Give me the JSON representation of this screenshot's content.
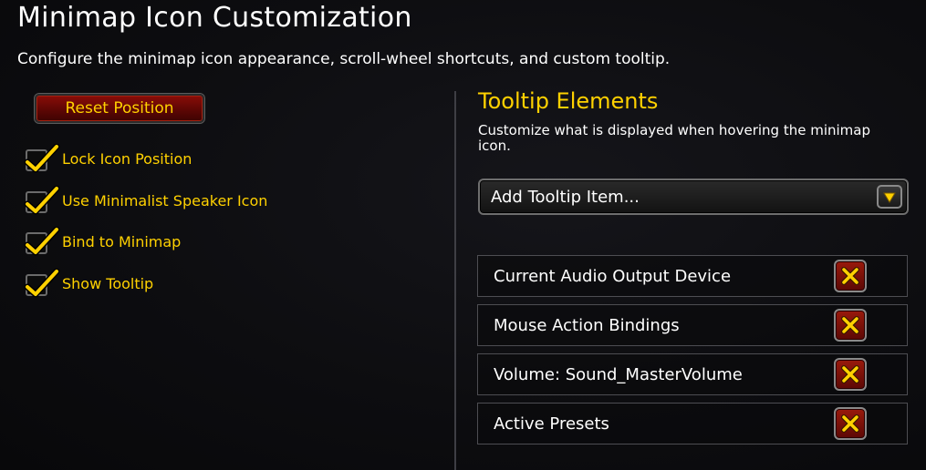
{
  "header": {
    "title": "Minimap Icon Customization",
    "subtitle": "Configure the minimap icon appearance, scroll-wheel shortcuts, and custom tooltip."
  },
  "left_panel": {
    "reset_button_label": "Reset Position",
    "checkboxes": [
      {
        "label": "Lock Icon Position",
        "checked": true
      },
      {
        "label": "Use Minimalist Speaker Icon",
        "checked": true
      },
      {
        "label": "Bind to Minimap",
        "checked": true
      },
      {
        "label": "Show Tooltip",
        "checked": true
      }
    ]
  },
  "right_panel": {
    "section_title": "Tooltip Elements",
    "section_description": "Customize what is displayed when hovering the minimap icon.",
    "dropdown": {
      "selected": "Add Tooltip Item...",
      "arrow_icon": "chevron-down-icon"
    },
    "tooltip_items": [
      {
        "label": "Current Audio Output Device",
        "remove_icon": "close-icon"
      },
      {
        "label": "Mouse Action Bindings",
        "remove_icon": "close-icon"
      },
      {
        "label": "Volume: Sound_MasterVolume",
        "remove_icon": "close-icon"
      },
      {
        "label": "Active Presets",
        "remove_icon": "close-icon"
      }
    ]
  },
  "colors": {
    "accent_gold": "#ffd100",
    "button_red": "#8a0d08",
    "background": "#0d0d10"
  }
}
